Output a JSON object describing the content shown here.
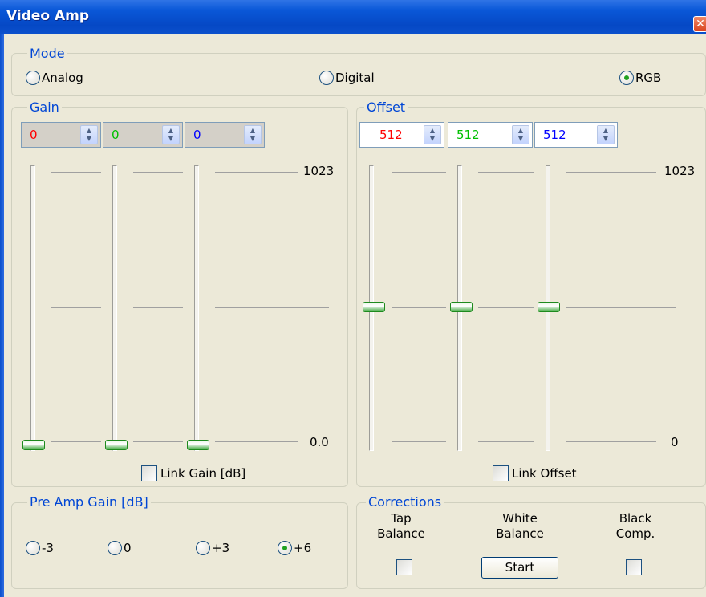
{
  "window": {
    "title": "Video Amp",
    "close_glyph": "✕"
  },
  "mode": {
    "title": "Mode",
    "options": [
      {
        "label": "Analog",
        "checked": false
      },
      {
        "label": "Digital",
        "checked": false
      },
      {
        "label": "RGB",
        "checked": true
      }
    ]
  },
  "gain": {
    "title": "Gain",
    "channels": [
      {
        "value": "0",
        "color": "#ff0000"
      },
      {
        "value": "0",
        "color": "#00c000"
      },
      {
        "value": "0",
        "color": "#0000ff"
      }
    ],
    "scale_max": "1023",
    "scale_min": "0.0",
    "link_label": "Link Gain [dB]",
    "link_checked": false
  },
  "offset": {
    "title": "Offset",
    "channels": [
      {
        "value": "512",
        "color": "#ff0000"
      },
      {
        "value": "512",
        "color": "#00c000"
      },
      {
        "value": "512",
        "color": "#0000ff"
      }
    ],
    "scale_max": "1023",
    "scale_min": "0",
    "link_label": "Link Offset",
    "link_checked": false
  },
  "preamp": {
    "title": "Pre Amp Gain [dB]",
    "options": [
      {
        "label": "-3",
        "checked": false
      },
      {
        "label": "0",
        "checked": false
      },
      {
        "label": "+3",
        "checked": false
      },
      {
        "label": "+6",
        "checked": true
      }
    ]
  },
  "corrections": {
    "title": "Corrections",
    "tap_label_1": "Tap",
    "tap_label_2": "Balance",
    "white_label_1": "White",
    "white_label_2": "Balance",
    "start_label": "Start",
    "black_label_1": "Black",
    "black_label_2": "Comp."
  },
  "colors": {
    "accent": "#0046d5",
    "thumb": "#3da83d"
  }
}
